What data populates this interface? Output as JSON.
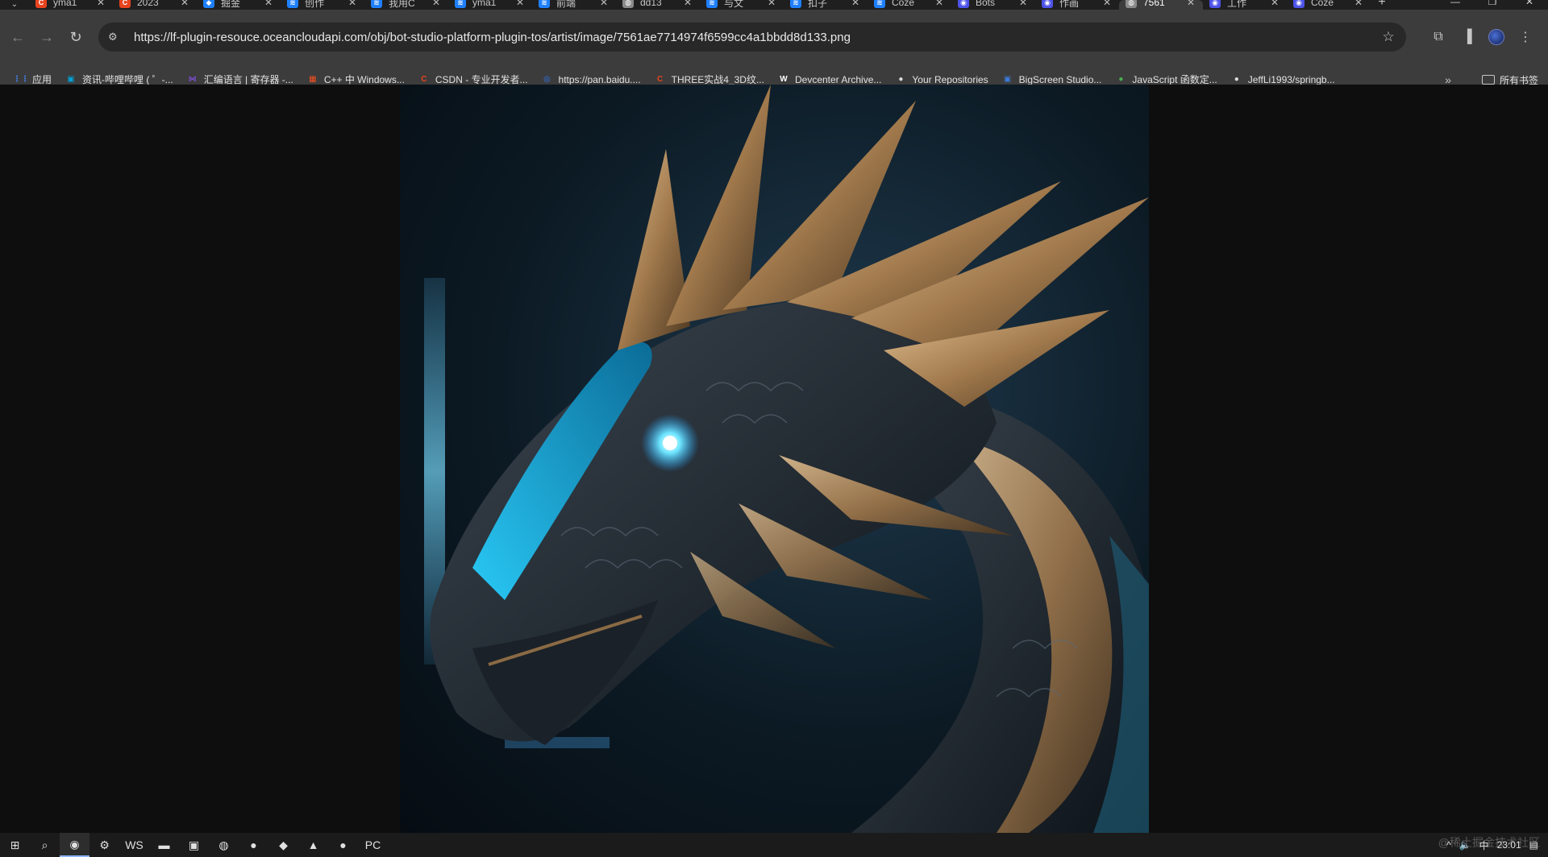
{
  "browser": {
    "tabs": [
      {
        "title": "yma1",
        "favicon_color": "#e8431f",
        "favicon_glyph": "C"
      },
      {
        "title": "2023",
        "favicon_color": "#e8431f",
        "favicon_glyph": "C"
      },
      {
        "title": "掘金",
        "favicon_color": "#1e80ff",
        "favicon_glyph": "◆"
      },
      {
        "title": "创作",
        "favicon_color": "#1e80ff",
        "favicon_glyph": "≋"
      },
      {
        "title": "我用C",
        "favicon_color": "#1e80ff",
        "favicon_glyph": "≋"
      },
      {
        "title": "yma1",
        "favicon_color": "#1e80ff",
        "favicon_glyph": "≋"
      },
      {
        "title": "前端",
        "favicon_color": "#1e80ff",
        "favicon_glyph": "≋"
      },
      {
        "title": "dd13",
        "favicon_color": "#8a8a8a",
        "favicon_glyph": "◍"
      },
      {
        "title": "与文",
        "favicon_color": "#1e80ff",
        "favicon_glyph": "≋"
      },
      {
        "title": "扣子",
        "favicon_color": "#1e80ff",
        "favicon_glyph": "≋"
      },
      {
        "title": "Coze",
        "favicon_color": "#1e80ff",
        "favicon_glyph": "≋"
      },
      {
        "title": "Bots",
        "favicon_color": "#4d53e8",
        "favicon_glyph": "◉"
      },
      {
        "title": "作画",
        "favicon_color": "#4d53e8",
        "favicon_glyph": "◉"
      },
      {
        "title": "7561",
        "favicon_color": "#8a8a8a",
        "favicon_glyph": "◍",
        "active": true
      },
      {
        "title": "工作",
        "favicon_color": "#4d53e8",
        "favicon_glyph": "◉"
      },
      {
        "title": "Coze",
        "favicon_color": "#4d53e8",
        "favicon_glyph": "◉"
      }
    ],
    "new_tab_glyph": "+",
    "url": "https://lf-plugin-resouce.oceancloudapi.com/obj/bot-studio-platform-plugin-tos/artist/image/7561ae7714974f6599cc4a1bbdd8d133.png",
    "bookmarks": [
      {
        "label": "应用",
        "icon_color": "#4285f4",
        "glyph": "⋮⋮"
      },
      {
        "label": "资讯-哔哩哔哩 ( ゜-...",
        "icon_color": "#00a1d6",
        "glyph": "▣"
      },
      {
        "label": "汇编语言 | 寄存器 -...",
        "icon_color": "#7b4fd1",
        "glyph": "⋈"
      },
      {
        "label": "C++ 中 Windows...",
        "icon_color": "#f25022",
        "glyph": "▦"
      },
      {
        "label": "CSDN - 专业开发者...",
        "icon_color": "#e8431f",
        "glyph": "C"
      },
      {
        "label": "https://pan.baidu....",
        "icon_color": "#2b7cff",
        "glyph": "◎"
      },
      {
        "label": "THREE实战4_3D纹...",
        "icon_color": "#e8431f",
        "glyph": "C"
      },
      {
        "label": "Devcenter Archive...",
        "icon_color": "#ffffff",
        "glyph": "W"
      },
      {
        "label": "Your Repositories",
        "icon_color": "#dddddd",
        "glyph": "●"
      },
      {
        "label": "BigScreen Studio...",
        "icon_color": "#3b7bd8",
        "glyph": "▣"
      },
      {
        "label": "JavaScript 函数定...",
        "icon_color": "#4caf50",
        "glyph": "●"
      },
      {
        "label": "JeffLi1993/springb...",
        "icon_color": "#dddddd",
        "glyph": "●"
      }
    ],
    "bookmarks_more": "»",
    "all_bookmarks": "所有书签"
  },
  "taskbar": {
    "items": [
      {
        "name": "start",
        "glyph": "⊞"
      },
      {
        "name": "search",
        "glyph": "⌕"
      },
      {
        "name": "chrome",
        "glyph": "◉",
        "active": true
      },
      {
        "name": "settings",
        "glyph": "⚙"
      },
      {
        "name": "webstorm",
        "glyph": "WS"
      },
      {
        "name": "explorer",
        "glyph": "▬"
      },
      {
        "name": "app",
        "glyph": "▣"
      },
      {
        "name": "browser",
        "glyph": "◍"
      },
      {
        "name": "qq",
        "glyph": "●"
      },
      {
        "name": "app-red",
        "glyph": "◆"
      },
      {
        "name": "app-purple",
        "glyph": "▲"
      },
      {
        "name": "wechat",
        "glyph": "●"
      },
      {
        "name": "pycharm",
        "glyph": "PC"
      }
    ],
    "tray": {
      "ime": "中",
      "time": "23:01"
    },
    "watermark": "@稀土掘金技术社区"
  },
  "colors": {
    "tab_strip": "#1f1f1f",
    "toolbar": "#3c3c3c",
    "omnibox": "#282828",
    "page_bg": "#0e0e0e",
    "dragon_glow": "#2ad4ff",
    "dragon_gold": "#b08a5a"
  }
}
